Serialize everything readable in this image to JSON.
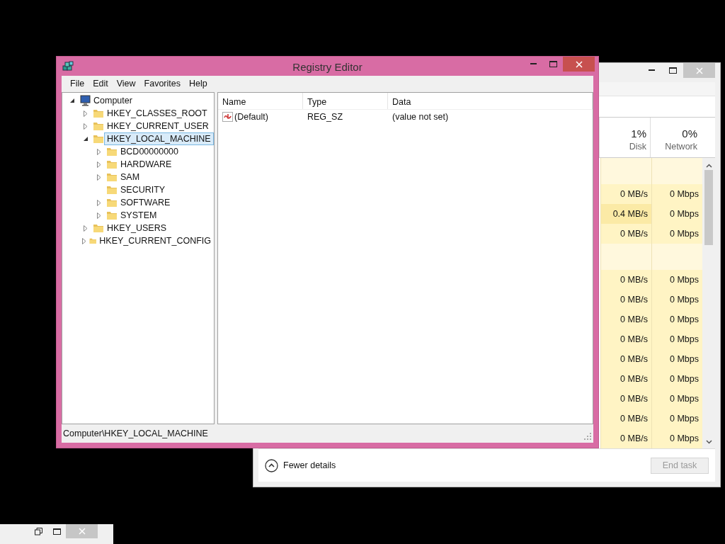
{
  "registry_editor": {
    "title": "Registry Editor",
    "menu": [
      "File",
      "Edit",
      "View",
      "Favorites",
      "Help"
    ],
    "tree": [
      {
        "label": "Computer",
        "kind": "computer",
        "expanded": true,
        "selected": false,
        "children": [
          {
            "label": "HKEY_CLASSES_ROOT",
            "kind": "folder",
            "expanded": false,
            "selected": false
          },
          {
            "label": "HKEY_CURRENT_USER",
            "kind": "folder",
            "expanded": false,
            "selected": false
          },
          {
            "label": "HKEY_LOCAL_MACHINE",
            "kind": "folder",
            "expanded": true,
            "selected": true,
            "children": [
              {
                "label": "BCD00000000",
                "kind": "folder",
                "expanded": false,
                "selected": false
              },
              {
                "label": "HARDWARE",
                "kind": "folder",
                "expanded": false,
                "selected": false
              },
              {
                "label": "SAM",
                "kind": "folder",
                "expanded": false,
                "selected": false
              },
              {
                "label": "SECURITY",
                "kind": "folder",
                "selected": false
              },
              {
                "label": "SOFTWARE",
                "kind": "folder",
                "expanded": false,
                "selected": false
              },
              {
                "label": "SYSTEM",
                "kind": "folder",
                "expanded": false,
                "selected": false
              }
            ]
          },
          {
            "label": "HKEY_USERS",
            "kind": "folder",
            "expanded": false,
            "selected": false
          },
          {
            "label": "HKEY_CURRENT_CONFIG",
            "kind": "folder",
            "expanded": false,
            "selected": false
          }
        ]
      }
    ],
    "columns": [
      "Name",
      "Type",
      "Data"
    ],
    "values": [
      {
        "name": "(Default)",
        "type": "REG_SZ",
        "data": "(value not set)"
      }
    ],
    "status_bar": "Computer\\HKEY_LOCAL_MACHINE"
  },
  "task_manager": {
    "columns": [
      {
        "percent": "1%",
        "label": "Disk"
      },
      {
        "percent": "0%",
        "label": "Network"
      }
    ],
    "sections": [
      {
        "rows": [
          {
            "disk": "0 MB/s",
            "network": "0 Mbps",
            "highlighted": false
          },
          {
            "disk": "0.4 MB/s",
            "network": "0 Mbps",
            "highlighted": true
          },
          {
            "disk": "0 MB/s",
            "network": "0 Mbps",
            "highlighted": false
          }
        ]
      },
      {
        "rows": [
          {
            "disk": "0 MB/s",
            "network": "0 Mbps",
            "highlighted": false
          },
          {
            "disk": "0 MB/s",
            "network": "0 Mbps",
            "highlighted": false
          },
          {
            "disk": "0 MB/s",
            "network": "0 Mbps",
            "highlighted": false
          },
          {
            "disk": "0 MB/s",
            "network": "0 Mbps",
            "highlighted": false
          },
          {
            "disk": "0 MB/s",
            "network": "0 Mbps",
            "highlighted": false
          },
          {
            "disk": "0 MB/s",
            "network": "0 Mbps",
            "highlighted": false
          },
          {
            "disk": "0 MB/s",
            "network": "0 Mbps",
            "highlighted": false
          },
          {
            "disk": "0 MB/s",
            "network": "0 Mbps",
            "highlighted": false
          },
          {
            "disk": "0 MB/s",
            "network": "0 Mbps",
            "highlighted": false
          }
        ]
      }
    ],
    "fewer_details": "Fewer details",
    "end_task": {
      "label": "End task",
      "disabled": true
    }
  }
}
